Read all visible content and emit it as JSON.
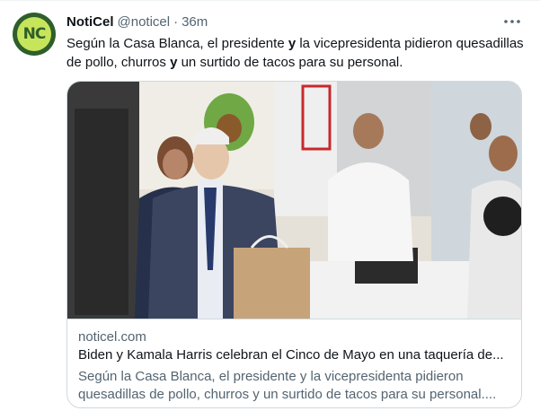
{
  "tweet": {
    "author": {
      "name": "NotiCel",
      "handle": "@noticel",
      "avatar_text": "NC",
      "avatar_bg": "#2f5e2c",
      "avatar_fg": "#c7e55a"
    },
    "separator": "·",
    "time": "36m",
    "more_icon": "more-horizontal-icon",
    "text_parts": [
      "Según la Casa Blanca, el presidente ",
      "y",
      " la vicepresidenta pidieron quesadillas de pollo, churros ",
      "y",
      " un surtido de tacos para su personal."
    ]
  },
  "card": {
    "image_description_icon": "news-photo",
    "domain": "noticel.com",
    "title": "Biden y Kamala Harris celebran el Cinco de Mayo en una taquería de...",
    "description": "Según la Casa Blanca, el presidente y la vicepresidenta pidieron quesadillas de pollo, churros y un surtido de tacos para su personal...."
  },
  "colors": {
    "text_primary": "#0f1419",
    "text_secondary": "#536471",
    "border": "#cfd9de"
  }
}
